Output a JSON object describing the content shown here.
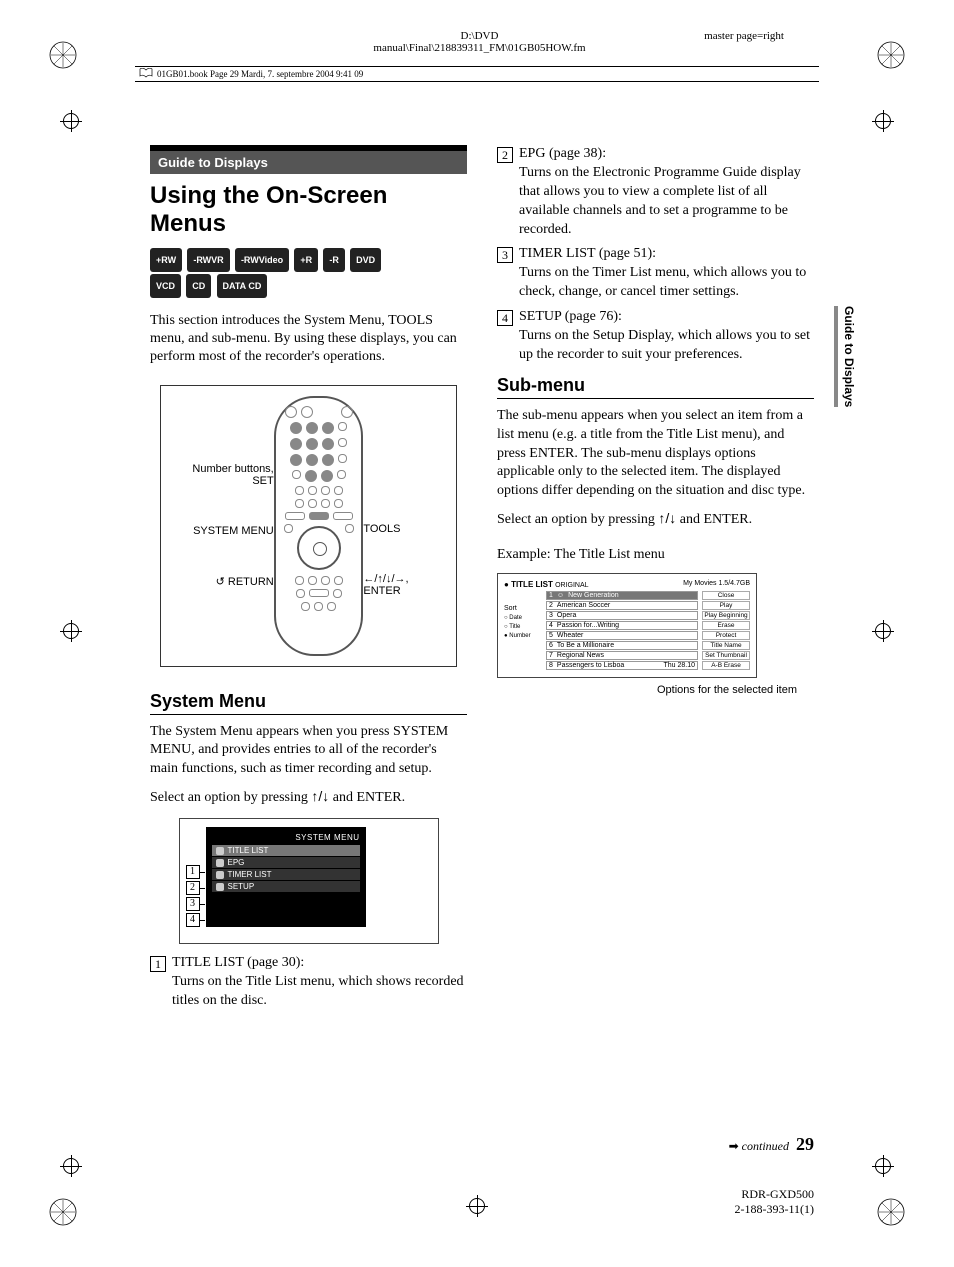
{
  "header": {
    "path1": "D:\\DVD",
    "path2": "manual\\Final\\218839311_FM\\01GB05HOW.fm",
    "masterpage": "master page=right",
    "bookline": "01GB01.book  Page 29  Mardi, 7. septembre 2004  9:41 09"
  },
  "sidebar_tab": "Guide to Displays",
  "section_tag": "Guide to Displays",
  "title": "Using the On-Screen Menus",
  "badges": [
    "+RW",
    "-RWVR",
    "-RWVideo",
    "+R",
    "-R",
    "DVD",
    "VCD",
    "CD",
    "DATA CD"
  ],
  "intro": "This section introduces the System Menu, TOOLS menu, and sub-menu. By using these displays, you can perform most of the recorder's operations.",
  "remote_labels": {
    "left1": "Number buttons, SET",
    "left2": "SYSTEM MENU",
    "left3": "RETURN",
    "right1": "TOOLS",
    "right2": "←/↑/↓/→, ENTER"
  },
  "system_menu": {
    "heading": "System Menu",
    "body1": "The System Menu appears when you press SYSTEM MENU, and provides entries to all of the recorder's main functions, such as timer recording and setup.",
    "body2a": "Select an option by pressing ",
    "body2b": " and ENTER.",
    "arrows": "↑/↓",
    "screen_title": "SYSTEM MENU",
    "items": [
      "TITLE LIST",
      "EPG",
      "TIMER LIST",
      "SETUP"
    ],
    "numbered": [
      {
        "n": "1",
        "title": "TITLE LIST (page 30):",
        "desc": "Turns on the Title List menu, which shows recorded titles on the disc."
      },
      {
        "n": "2",
        "title": "EPG (page 38):",
        "desc": "Turns on the Electronic Programme Guide display that allows you to view a complete list of all available channels and to set a programme to be recorded."
      },
      {
        "n": "3",
        "title": "TIMER LIST (page 51):",
        "desc": "Turns on the Timer List menu, which allows you to check, change, or cancel timer settings."
      },
      {
        "n": "4",
        "title": "SETUP (page 76):",
        "desc": "Turns on the Setup Display, which allows you to set up the recorder to suit your preferences."
      }
    ]
  },
  "submenu": {
    "heading": "Sub-menu",
    "body1": "The sub-menu appears when you select an item from a list menu (e.g. a title from the Title List menu), and press ENTER. The sub-menu displays options applicable only to the selected item. The displayed options differ depending on the situation and disc type.",
    "body2a": "Select an option by pressing ",
    "body2b": " and ENTER.",
    "arrows": "↑/↓",
    "example": "Example: The Title List menu",
    "tl_header": "TITLE LIST",
    "tl_header_sub": "ORIGINAL",
    "tl_header_right": "My Movies   1.5/4.7GB",
    "sort_label": "Sort",
    "sort_opts": [
      "Date",
      "Title",
      "Number"
    ],
    "rows": [
      {
        "n": "1",
        "t": "New Generation"
      },
      {
        "n": "2",
        "t": "American Soccer"
      },
      {
        "n": "3",
        "t": "Opera"
      },
      {
        "n": "4",
        "t": "Passion for...Writing"
      },
      {
        "n": "5",
        "t": "Wheater"
      },
      {
        "n": "6",
        "t": "To Be a Millionaire"
      },
      {
        "n": "7",
        "t": "Regional News"
      },
      {
        "n": "8",
        "t": "Passengers to Lisboa"
      }
    ],
    "date": "Thu 28.10",
    "options": [
      "Close",
      "Play",
      "Play Beginning",
      "Erase",
      "Protect",
      "Title Name",
      "Set Thumbnail",
      "A-B Erase"
    ],
    "caption": "Options for the selected item"
  },
  "footer": {
    "continued": "continued",
    "page": "29",
    "model": "RDR-GXD500",
    "part": "2-188-393-11(1)"
  }
}
